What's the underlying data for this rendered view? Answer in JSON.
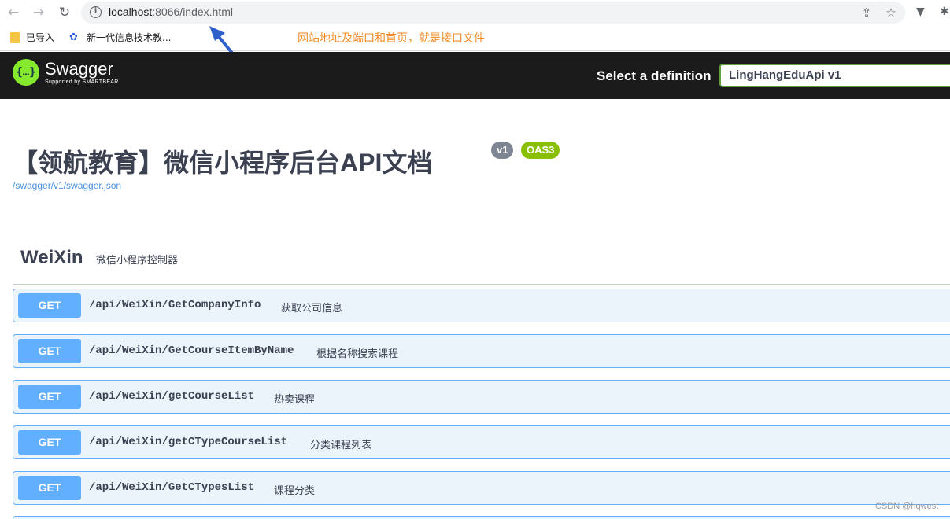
{
  "browser": {
    "url_host": "localhost",
    "url_rest": ":8066/index.html",
    "bookmarks": [
      {
        "label": "已导入",
        "icon": "folder-icon"
      },
      {
        "label": "新一代信息技术教...",
        "icon": "paw-icon"
      }
    ]
  },
  "annotation": {
    "text": "网站地址及端口和首页，就是接口文件",
    "color": "#f08a24"
  },
  "topbar": {
    "logo_name": "Swagger",
    "logo_sub": "Supported by SMARTBEAR",
    "select_label": "Select a definition",
    "select_value": "LingHangEduApi v1"
  },
  "info": {
    "title": "【领航教育】微信小程序后台API文档",
    "version_badge": "v1",
    "oas_badge": "OAS3",
    "spec_link": "/swagger/v1/swagger.json"
  },
  "tag": {
    "name": "WeiXin",
    "description": "微信小程序控制器"
  },
  "operations": [
    {
      "method": "GET",
      "path": "/api/WeiXin/GetCompanyInfo",
      "summary": "获取公司信息"
    },
    {
      "method": "GET",
      "path": "/api/WeiXin/GetCourseItemByName",
      "summary": "根据名称搜索课程"
    },
    {
      "method": "GET",
      "path": "/api/WeiXin/getCourseList",
      "summary": "热卖课程"
    },
    {
      "method": "GET",
      "path": "/api/WeiXin/getCTypeCourseList",
      "summary": "分类课程列表"
    },
    {
      "method": "GET",
      "path": "/api/WeiXin/GetCTypesList",
      "summary": "课程分类"
    }
  ],
  "watermark": "CSDN @hqwest",
  "colors": {
    "get_method": "#61affe",
    "get_bg": "#ebf3fb",
    "topbar": "#1b1b1b",
    "logo": "#85ea2d",
    "select_border": "#62a03f",
    "oas_badge": "#89bf04"
  }
}
